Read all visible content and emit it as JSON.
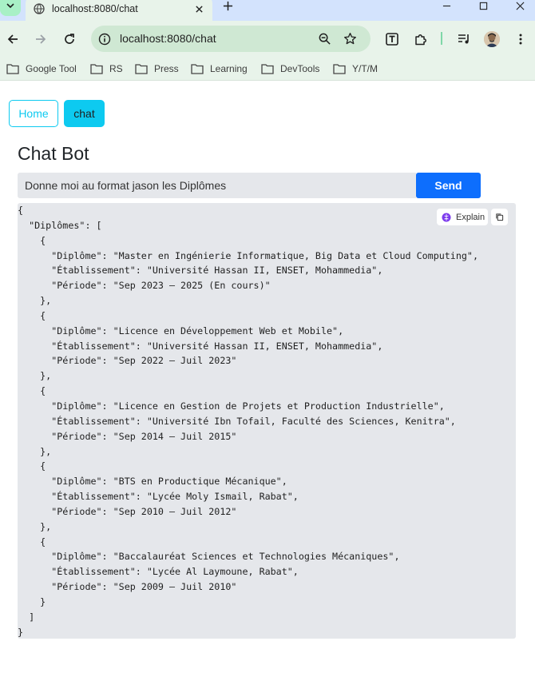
{
  "browser": {
    "tab_title": "localhost:8080/chat",
    "url": "localhost:8080/chat",
    "bookmarks": [
      {
        "label": "Google Tool"
      },
      {
        "label": "RS"
      },
      {
        "label": "Press"
      },
      {
        "label": "Learning"
      },
      {
        "label": "DevTools"
      },
      {
        "label": "Y/T/M"
      }
    ]
  },
  "nav": {
    "home_label": "Home",
    "chat_label": "chat"
  },
  "page": {
    "title": "Chat Bot",
    "input_value": "Donne moi au format jason les Diplômes",
    "send_label": "Send"
  },
  "response": {
    "explain_label": "Explain",
    "code_lines": [
      "{",
      "  \"Diplômes\": [",
      "    {",
      "      \"Diplôme\": \"Master en Ingénierie Informatique, Big Data et Cloud Computing\",",
      "      \"Établissement\": \"Université Hassan II, ENSET, Mohammedia\",",
      "      \"Période\": \"Sep 2023 – 2025 (En cours)\"",
      "    },",
      "    {",
      "      \"Diplôme\": \"Licence en Développement Web et Mobile\",",
      "      \"Établissement\": \"Université Hassan II, ENSET, Mohammedia\",",
      "      \"Période\": \"Sep 2022 – Juil 2023\"",
      "    },",
      "    {",
      "      \"Diplôme\": \"Licence en Gestion de Projets et Production Industrielle\",",
      "      \"Établissement\": \"Université Ibn Tofail, Faculté des Sciences, Kenitra\",",
      "      \"Période\": \"Sep 2014 – Juil 2015\"",
      "    },",
      "    {",
      "      \"Diplôme\": \"BTS en Productique Mécanique\",",
      "      \"Établissement\": \"Lycée Moly Ismail, Rabat\",",
      "      \"Période\": \"Sep 2010 – Juil 2012\"",
      "    },",
      "    {",
      "      \"Diplôme\": \"Baccalauréat Sciences et Technologies Mécaniques\",",
      "      \"Établissement\": \"Lycée Al Laymoune, Rabat\",",
      "      \"Période\": \"Sep 2009 – Juil 2010\"",
      "    }",
      "  ]",
      "}"
    ]
  },
  "colors": {
    "accent_cyan": "#0dcaf0",
    "send_blue": "#0d6efd",
    "chrome_green": "#e8f3ea",
    "code_bg": "#e5e7eb"
  }
}
